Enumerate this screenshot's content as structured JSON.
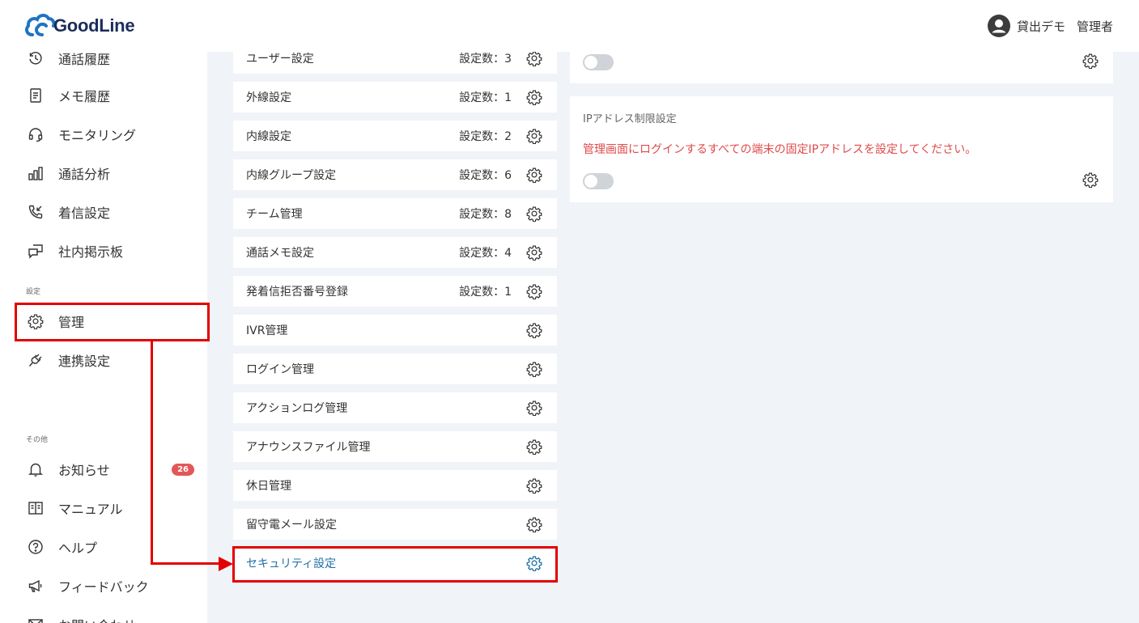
{
  "header": {
    "logo_text": "GoodLine",
    "user_name": "貸出デモ",
    "user_role": "管理者"
  },
  "sidebar": {
    "items": [
      {
        "label": "通話履歴",
        "icon": "history-icon"
      },
      {
        "label": "メモ履歴",
        "icon": "memo-icon"
      },
      {
        "label": "モニタリング",
        "icon": "headset-icon"
      },
      {
        "label": "通話分析",
        "icon": "bar-chart-icon"
      },
      {
        "label": "着信設定",
        "icon": "incoming-call-icon"
      },
      {
        "label": "社内掲示板",
        "icon": "chat-board-icon"
      }
    ],
    "section_settings": "設定",
    "settings_items": [
      {
        "label": "管理",
        "icon": "gear-icon"
      },
      {
        "label": "連携設定",
        "icon": "plug-icon"
      }
    ],
    "section_other": "その他",
    "other_items": [
      {
        "label": "お知らせ",
        "icon": "bell-icon",
        "badge": "26"
      },
      {
        "label": "マニュアル",
        "icon": "book-icon"
      },
      {
        "label": "ヘルプ",
        "icon": "help-icon"
      },
      {
        "label": "フィードバック",
        "icon": "megaphone-icon"
      },
      {
        "label": "お問い合わせ",
        "icon": "mail-icon"
      }
    ]
  },
  "settings_list": [
    {
      "label": "ユーザー設定",
      "count": "設定数：3"
    },
    {
      "label": "外線設定",
      "count": "設定数：1"
    },
    {
      "label": "内線設定",
      "count": "設定数：2"
    },
    {
      "label": "内線グループ設定",
      "count": "設定数：6"
    },
    {
      "label": "チーム管理",
      "count": "設定数：8"
    },
    {
      "label": "通話メモ設定",
      "count": "設定数：4"
    },
    {
      "label": "発着信拒否番号登録",
      "count": "設定数：1"
    },
    {
      "label": "IVR管理",
      "count": ""
    },
    {
      "label": "ログイン管理",
      "count": ""
    },
    {
      "label": "アクションログ管理",
      "count": ""
    },
    {
      "label": "アナウンスファイル管理",
      "count": ""
    },
    {
      "label": "休日管理",
      "count": ""
    },
    {
      "label": "留守電メール設定",
      "count": ""
    },
    {
      "label": "セキュリティ設定",
      "count": ""
    }
  ],
  "security": {
    "ip_title": "IPアドレス制限設定",
    "ip_desc": "管理画面にログインするすべての端末の固定IPアドレスを設定してください。",
    "top_toggle_on": false,
    "ip_toggle_on": false
  },
  "colors": {
    "accent": "#2170a8",
    "highlight": "#e30000",
    "warning_text": "#e04a4a",
    "badge": "#e35757",
    "main_bg": "#f0f3f8"
  }
}
